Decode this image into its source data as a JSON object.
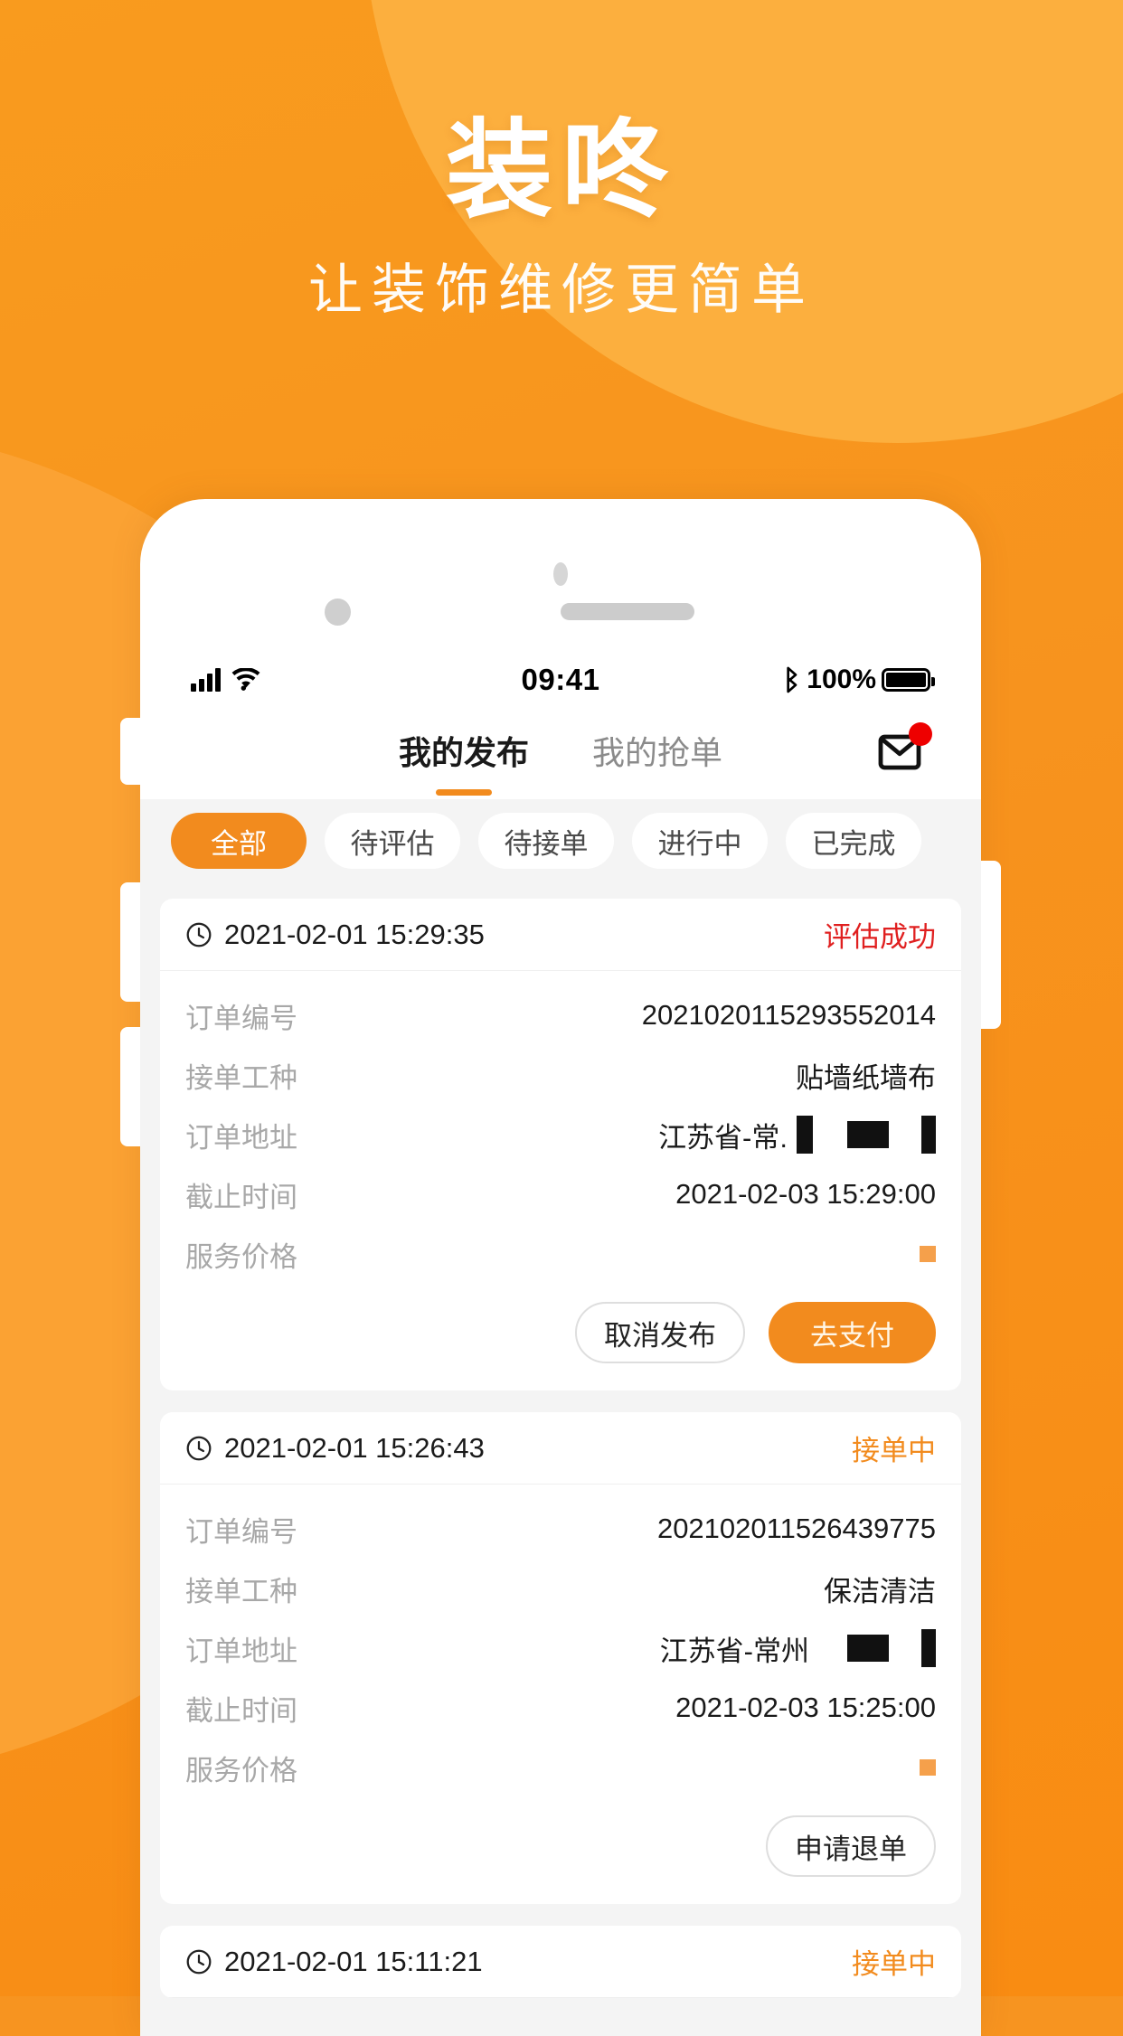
{
  "promo": {
    "title": "装咚",
    "subtitle": "让装饰维修更简单",
    "brand_color": "#F7931E",
    "accent_color": "#F28B1E"
  },
  "statusbar": {
    "time": "09:41",
    "battery_percent": "100%",
    "signal_icon": "cellular-signal-icon",
    "wifi_icon": "wifi-icon",
    "bluetooth_icon": "bluetooth-icon",
    "battery_icon": "battery-full-icon"
  },
  "app": {
    "tabs": [
      {
        "label": "我的发布",
        "active": true
      },
      {
        "label": "我的抢单",
        "active": false
      }
    ],
    "mail_icon": "mail-icon",
    "mail_badge": true,
    "filters": [
      {
        "label": "全部",
        "active": true
      },
      {
        "label": "待评估",
        "active": false
      },
      {
        "label": "待接单",
        "active": false
      },
      {
        "label": "进行中",
        "active": false
      },
      {
        "label": "已完成",
        "active": false
      }
    ],
    "field_labels": {
      "order_no": "订单编号",
      "work_type": "接单工种",
      "address": "订单地址",
      "deadline": "截止时间",
      "price": "服务价格"
    },
    "orders": [
      {
        "created_at": "2021-02-01 15:29:35",
        "status": "评估成功",
        "status_color": "red",
        "order_no": "2021020115293552014",
        "work_type": "贴墙纸墙布",
        "address": "江苏省-常.",
        "address_redacted": true,
        "deadline": "2021-02-03 15:29:00",
        "price": "",
        "price_redacted": true,
        "actions": [
          {
            "label": "取消发布",
            "style": "ghost"
          },
          {
            "label": "去支付",
            "style": "primary"
          }
        ]
      },
      {
        "created_at": "2021-02-01 15:26:43",
        "status": "接单中",
        "status_color": "orange",
        "order_no": "202102011526439775",
        "work_type": "保洁清洁",
        "address": "江苏省-常州",
        "address_redacted": true,
        "deadline": "2021-02-03 15:25:00",
        "price": "",
        "price_redacted": true,
        "actions": [
          {
            "label": "申请退单",
            "style": "ghost"
          }
        ]
      },
      {
        "created_at": "2021-02-01 15:11:21",
        "status": "接单中",
        "status_color": "orange"
      }
    ]
  }
}
